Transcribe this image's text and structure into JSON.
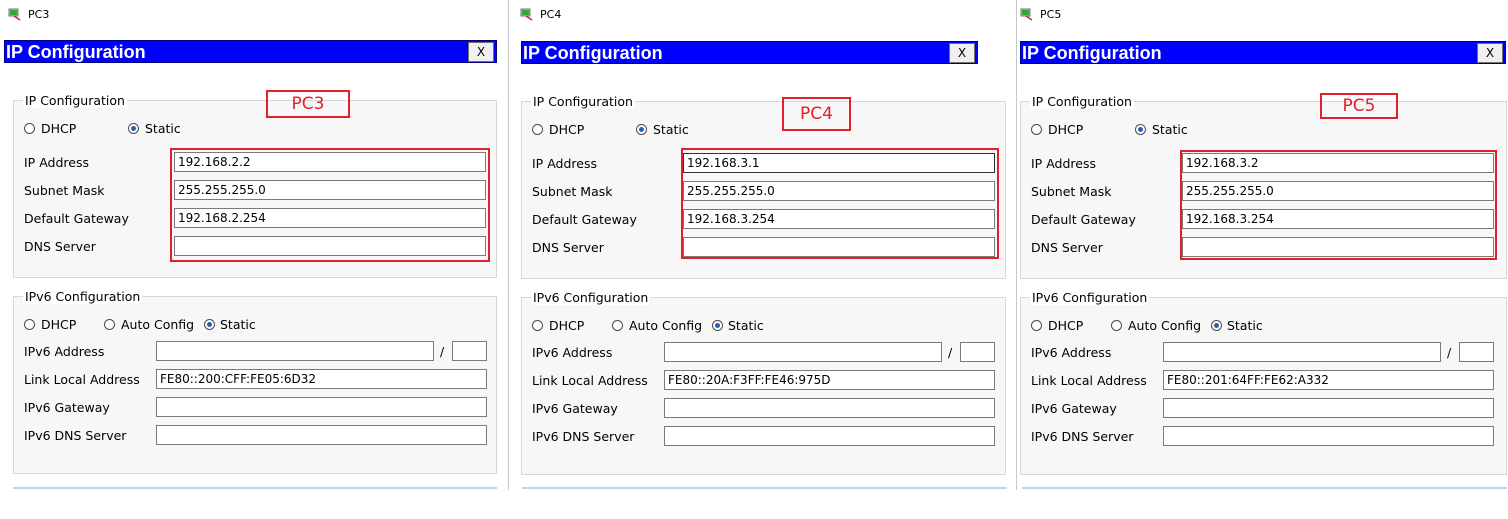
{
  "panels": [
    {
      "window_title": "PC3",
      "header_title": "IP Configuration",
      "close_label": "X",
      "pc_label": "PC3",
      "ipv4": {
        "legend": "IP Configuration",
        "dhcp_label": "DHCP",
        "static_label": "Static",
        "mode": "Static",
        "ip_address_label": "IP Address",
        "ip_address": "192.168.2.2",
        "subnet_mask_label": "Subnet Mask",
        "subnet_mask": "255.255.255.0",
        "gateway_label": "Default Gateway",
        "gateway": "192.168.2.254",
        "dns_label": "DNS Server",
        "dns": ""
      },
      "ipv6": {
        "legend": "IPv6 Configuration",
        "dhcp_label": "DHCP",
        "auto_label": "Auto Config",
        "static_label": "Static",
        "mode": "Static",
        "address_label": "IPv6 Address",
        "address": "",
        "slash": "/",
        "prefix": "",
        "link_local_label": "Link Local Address",
        "link_local": "FE80::200:CFF:FE05:6D32",
        "gateway_label": "IPv6 Gateway",
        "gateway": "",
        "dns_label": "IPv6 DNS Server",
        "dns": ""
      }
    },
    {
      "window_title": "PC4",
      "header_title": "IP Configuration",
      "close_label": "X",
      "pc_label": "PC4",
      "ipv4": {
        "legend": "IP Configuration",
        "dhcp_label": "DHCP",
        "static_label": "Static",
        "mode": "Static",
        "ip_address_label": "IP Address",
        "ip_address": "192.168.3.1",
        "subnet_mask_label": "Subnet Mask",
        "subnet_mask": "255.255.255.0",
        "gateway_label": "Default Gateway",
        "gateway": "192.168.3.254",
        "dns_label": "DNS Server",
        "dns": ""
      },
      "ipv6": {
        "legend": "IPv6 Configuration",
        "dhcp_label": "DHCP",
        "auto_label": "Auto Config",
        "static_label": "Static",
        "mode": "Static",
        "address_label": "IPv6 Address",
        "address": "",
        "slash": "/",
        "prefix": "",
        "link_local_label": "Link Local Address",
        "link_local": "FE80::20A:F3FF:FE46:975D",
        "gateway_label": "IPv6 Gateway",
        "gateway": "",
        "dns_label": "IPv6 DNS Server",
        "dns": ""
      }
    },
    {
      "window_title": "PC5",
      "header_title": "IP Configuration",
      "close_label": "X",
      "pc_label": "PC5",
      "ipv4": {
        "legend": "IP Configuration",
        "dhcp_label": "DHCP",
        "static_label": "Static",
        "mode": "Static",
        "ip_address_label": "IP Address",
        "ip_address": "192.168.3.2",
        "subnet_mask_label": "Subnet Mask",
        "subnet_mask": "255.255.255.0",
        "gateway_label": "Default Gateway",
        "gateway": "192.168.3.254",
        "dns_label": "DNS Server",
        "dns": ""
      },
      "ipv6": {
        "legend": "IPv6 Configuration",
        "dhcp_label": "DHCP",
        "auto_label": "Auto Config",
        "static_label": "Static",
        "mode": "Static",
        "address_label": "IPv6 Address",
        "address": "",
        "slash": "/",
        "prefix": "",
        "link_local_label": "Link Local Address",
        "link_local": "FE80::201:64FF:FE62:A332",
        "gateway_label": "IPv6 Gateway",
        "gateway": "",
        "dns_label": "IPv6 DNS Server",
        "dns": ""
      }
    }
  ],
  "colors": {
    "header_blue": "#0000ff",
    "annotation_red": "#e0202a",
    "radio_selected": "#2a5fb0"
  }
}
